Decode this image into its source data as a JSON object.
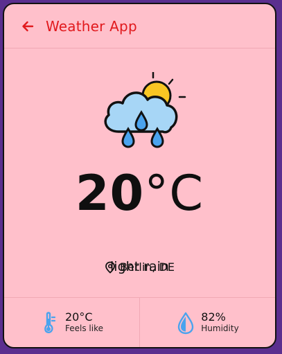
{
  "header": {
    "title": "Weather App",
    "back_icon": "arrow-left-icon"
  },
  "weather": {
    "icon": "rain-cloud-sun-icon",
    "temp_value": "20",
    "temp_unit": "°C",
    "description": "light rain",
    "location": "Berlin, DE",
    "location_icon": "map-pin-icon"
  },
  "stats": {
    "feels_like_value": "20°C",
    "feels_like_label": "Feels like",
    "feels_like_icon": "thermometer-icon",
    "humidity_value": "82%",
    "humidity_label": "Humidity",
    "humidity_icon": "droplet-icon"
  },
  "colors": {
    "background": "#5b2f8f",
    "card": "#ffc0cb",
    "accent": "#e1191d",
    "icon_blue": "#4aa3ee",
    "cloud": "#a7d6f6",
    "sun": "#f9c623"
  }
}
